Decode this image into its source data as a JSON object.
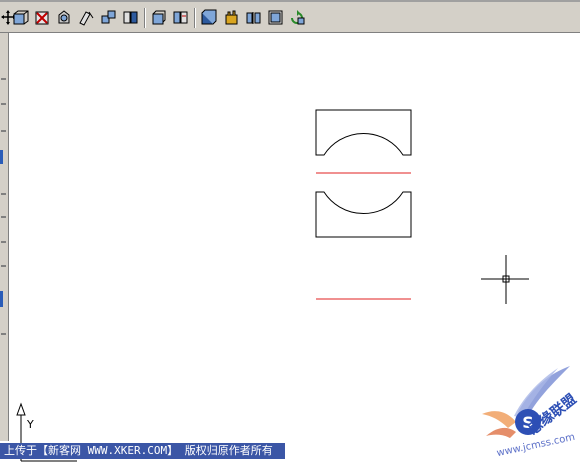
{
  "toolbar": {
    "buttons": [
      {
        "name": "pan-icon"
      },
      {
        "name": "solid-box-icon"
      },
      {
        "name": "solid-wedge-icon"
      },
      {
        "name": "solid-cone-icon"
      },
      {
        "name": "solid-sphere-icon"
      },
      {
        "name": "solid-torus-icon"
      },
      {
        "name": "extrude-icon"
      },
      {
        "name": "revolve-icon"
      },
      {
        "name": "slice-icon"
      },
      {
        "name": "section-icon"
      },
      {
        "name": "interfere-icon"
      },
      {
        "name": "setup-drawing-icon"
      },
      {
        "name": "setup-view-icon"
      },
      {
        "name": "setup-profile-icon"
      }
    ]
  },
  "canvas": {
    "ucs_axis_label": "Y",
    "crosshair": "cursor-crosshair"
  },
  "footer": {
    "text": "上传于【新客网 WWW.XKER.COM】 版权归原作者所有"
  },
  "watermark": {
    "logo_text": "思缘联盟",
    "site_text": "www.jcmss.com"
  },
  "colors": {
    "toolbar_bg": "#d4d0c8",
    "line_red": "#e02020",
    "footer_bg": "#3b56a6"
  }
}
